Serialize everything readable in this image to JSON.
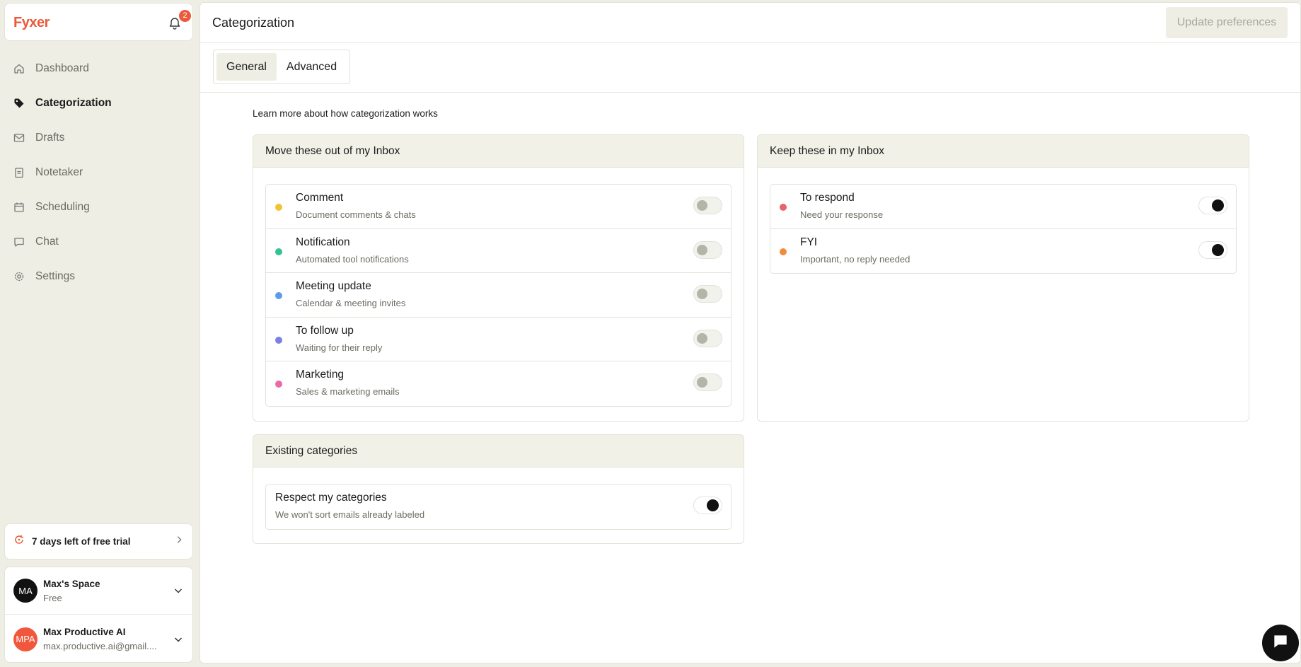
{
  "brand": {
    "logo": "Fyxer",
    "notification_count": "2"
  },
  "sidebar": {
    "items": [
      {
        "label": "Dashboard",
        "icon": "home-icon",
        "active": false
      },
      {
        "label": "Categorization",
        "icon": "tag-icon",
        "active": true
      },
      {
        "label": "Drafts",
        "icon": "mail-icon",
        "active": false
      },
      {
        "label": "Notetaker",
        "icon": "notepad-icon",
        "active": false
      },
      {
        "label": "Scheduling",
        "icon": "calendar-icon",
        "active": false
      },
      {
        "label": "Chat",
        "icon": "chat-bubble-icon",
        "active": false
      },
      {
        "label": "Settings",
        "icon": "gear-icon",
        "active": false
      }
    ],
    "trial": "7 days left of free trial",
    "workspace": {
      "initials": "MA",
      "name": "Max's Space",
      "plan": "Free"
    },
    "user": {
      "initials": "MPA",
      "name": "Max Productive AI",
      "email": "max.productive.ai@gmail...."
    }
  },
  "header": {
    "title": "Categorization",
    "update_button": "Update preferences"
  },
  "tabs": [
    {
      "label": "General",
      "active": true
    },
    {
      "label": "Advanced",
      "active": false
    }
  ],
  "learn_more": "Learn more about how categorization works",
  "move_panel": {
    "title": "Move these out of my Inbox",
    "rows": [
      {
        "title": "Comment",
        "desc": "Document comments & chats",
        "color": "#f1c232",
        "on": false
      },
      {
        "title": "Notification",
        "desc": "Automated tool notifications",
        "color": "#34c38f",
        "on": false
      },
      {
        "title": "Meeting update",
        "desc": "Calendar & meeting invites",
        "color": "#5b9bf0",
        "on": false
      },
      {
        "title": "To follow up",
        "desc": "Waiting for their reply",
        "color": "#7b80e6",
        "on": false
      },
      {
        "title": "Marketing",
        "desc": "Sales & marketing emails",
        "color": "#e86aa8",
        "on": false
      }
    ]
  },
  "keep_panel": {
    "title": "Keep these in my Inbox",
    "rows": [
      {
        "title": "To respond",
        "desc": "Need your response",
        "color": "#e8636a",
        "on": true
      },
      {
        "title": "FYI",
        "desc": "Important, no reply needed",
        "color": "#f08c3a",
        "on": true
      }
    ]
  },
  "existing_panel": {
    "title": "Existing categories",
    "row": {
      "title": "Respect my categories",
      "desc": "We won't sort emails already labeled",
      "on": true
    }
  },
  "colors": {
    "accent": "#ea5a3b",
    "sidebar_bg": "#eeeee4",
    "panel_head_bg": "#f1f1e7"
  }
}
